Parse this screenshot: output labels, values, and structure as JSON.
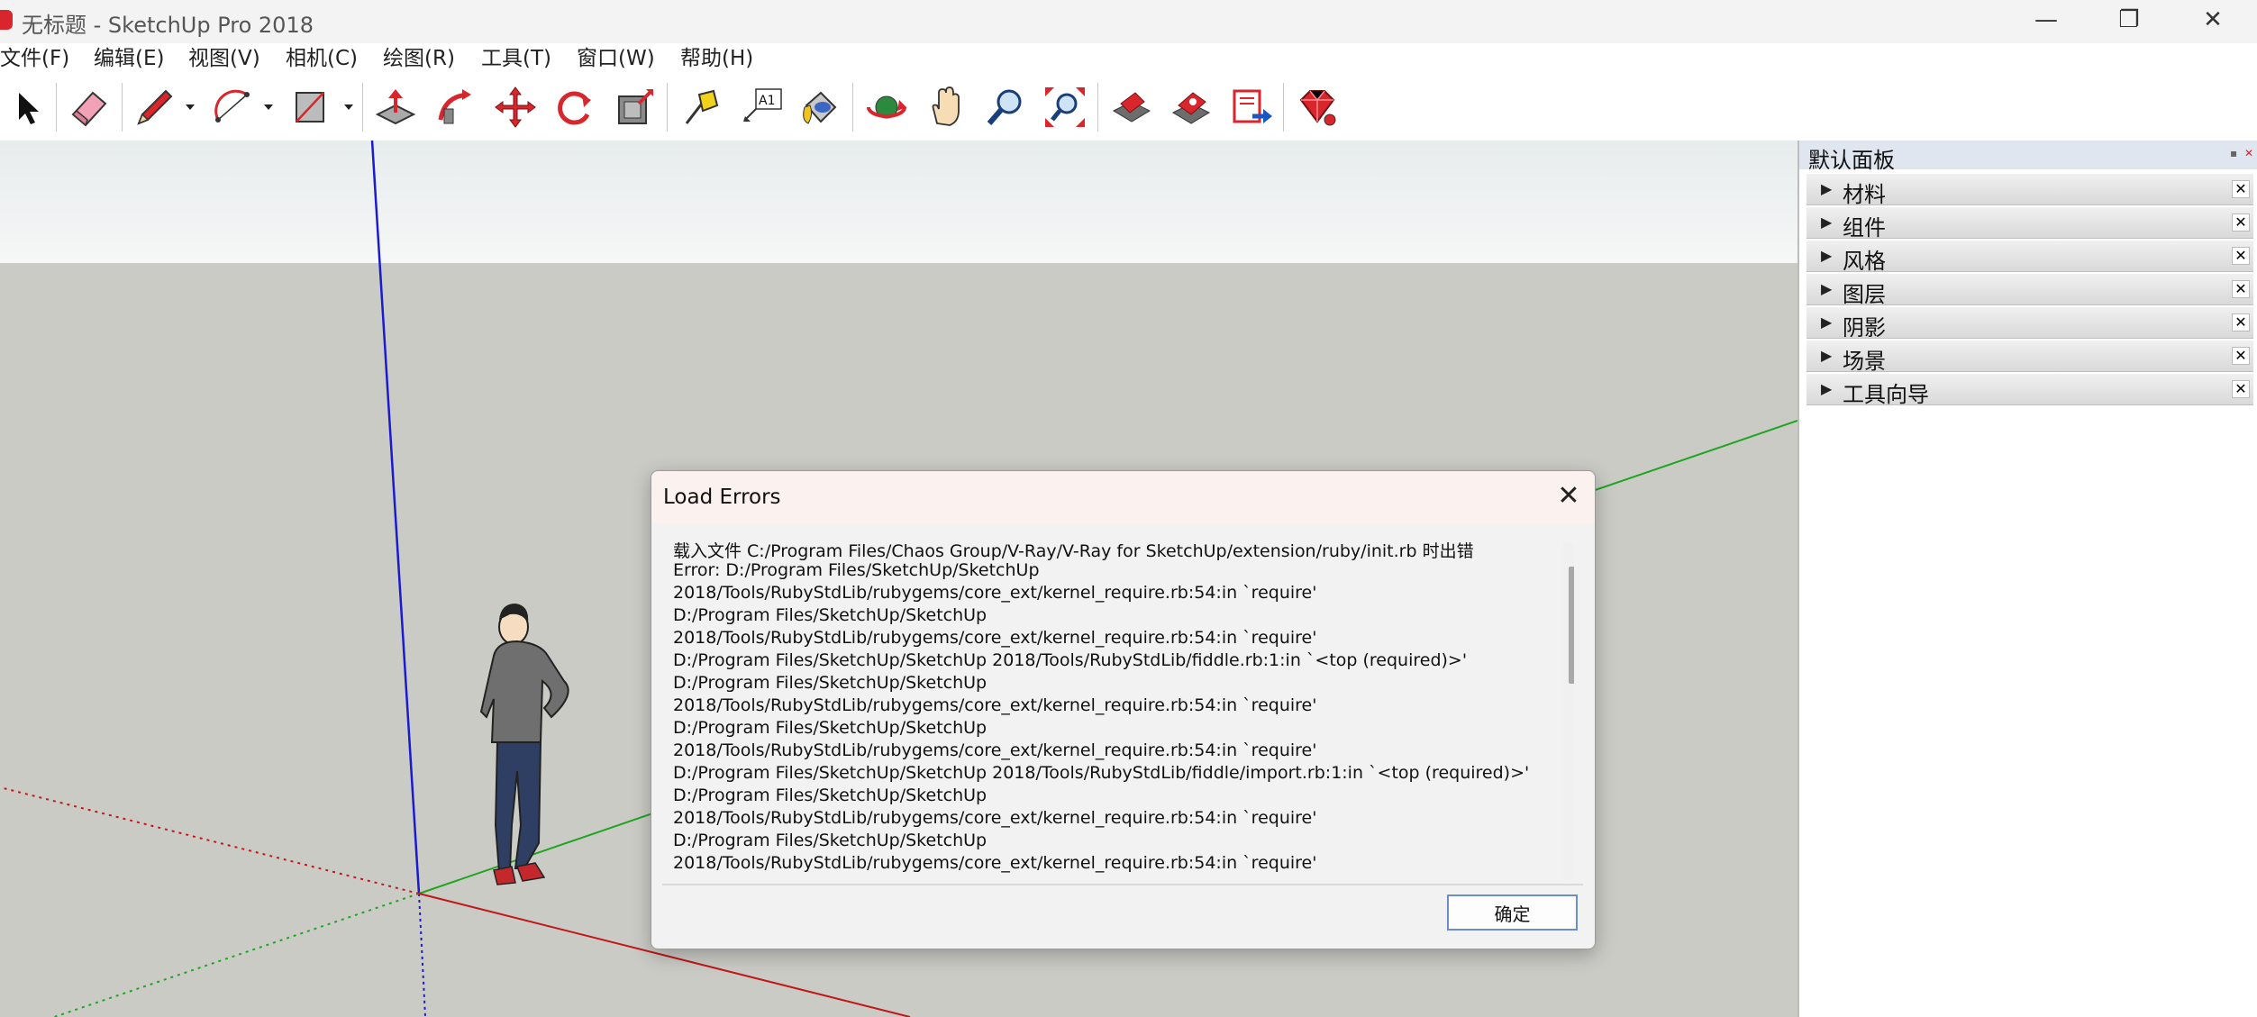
{
  "window": {
    "title": "无标题 - SketchUp Pro 2018",
    "minimize_label": "—",
    "maximize_label": "❐",
    "close_label": "✕",
    "app_icon": "sketchup-logo-icon"
  },
  "menu": [
    "文件(F)",
    "编辑(E)",
    "视图(V)",
    "相机(C)",
    "绘图(R)",
    "工具(T)",
    "窗口(W)",
    "帮助(H)"
  ],
  "toolbar": {
    "tools": [
      "select-icon",
      "eraser-icon",
      "pencil-icon",
      "arc-icon",
      "rectangle-icon",
      "push-pull-icon",
      "follow-me-icon",
      "move-icon",
      "rotate-icon",
      "offset-icon",
      "tape-measure-icon",
      "text-icon",
      "paint-bucket-icon",
      "orbit-icon",
      "pan-icon",
      "zoom-icon",
      "zoom-extents-icon",
      "warehouse-icon",
      "extension-warehouse-icon",
      "layout-icon",
      "ruby-console-icon"
    ],
    "text_tool_label": "A1"
  },
  "tray": {
    "title": "默认面板",
    "panels": [
      "材料",
      "组件",
      "风格",
      "图层",
      "阴影",
      "场景",
      "工具向导"
    ],
    "collapsed_arrow": "▶",
    "close_label": "✕"
  },
  "dialog": {
    "title": "Load Errors",
    "close_label": "✕",
    "lines": [
      "载入文件 C:/Program Files/Chaos Group/V-Ray/V-Ray for SketchUp/extension/ruby/init.rb 时出错",
      "Error: D:/Program Files/SketchUp/SketchUp",
      "2018/Tools/RubyStdLib/rubygems/core_ext/kernel_require.rb:54:in `require'",
      "D:/Program Files/SketchUp/SketchUp",
      "2018/Tools/RubyStdLib/rubygems/core_ext/kernel_require.rb:54:in `require'",
      "D:/Program Files/SketchUp/SketchUp 2018/Tools/RubyStdLib/fiddle.rb:1:in `<top (required)>'",
      "D:/Program Files/SketchUp/SketchUp",
      "2018/Tools/RubyStdLib/rubygems/core_ext/kernel_require.rb:54:in `require'",
      "D:/Program Files/SketchUp/SketchUp",
      "2018/Tools/RubyStdLib/rubygems/core_ext/kernel_require.rb:54:in `require'",
      "D:/Program Files/SketchUp/SketchUp 2018/Tools/RubyStdLib/fiddle/import.rb:1:in `<top (required)>'",
      "D:/Program Files/SketchUp/SketchUp",
      "2018/Tools/RubyStdLib/rubygems/core_ext/kernel_require.rb:54:in `require'",
      "D:/Program Files/SketchUp/SketchUp",
      "2018/Tools/RubyStdLib/rubygems/core_ext/kernel_require.rb:54:in `require'"
    ],
    "ok_label": "确定"
  },
  "colors": {
    "viewport_ground": "#cbcbc6",
    "axis_blue": "#1a1ad0",
    "axis_green": "#1fa51f",
    "axis_red": "#c21818",
    "ok_border": "#6a8fc8"
  }
}
